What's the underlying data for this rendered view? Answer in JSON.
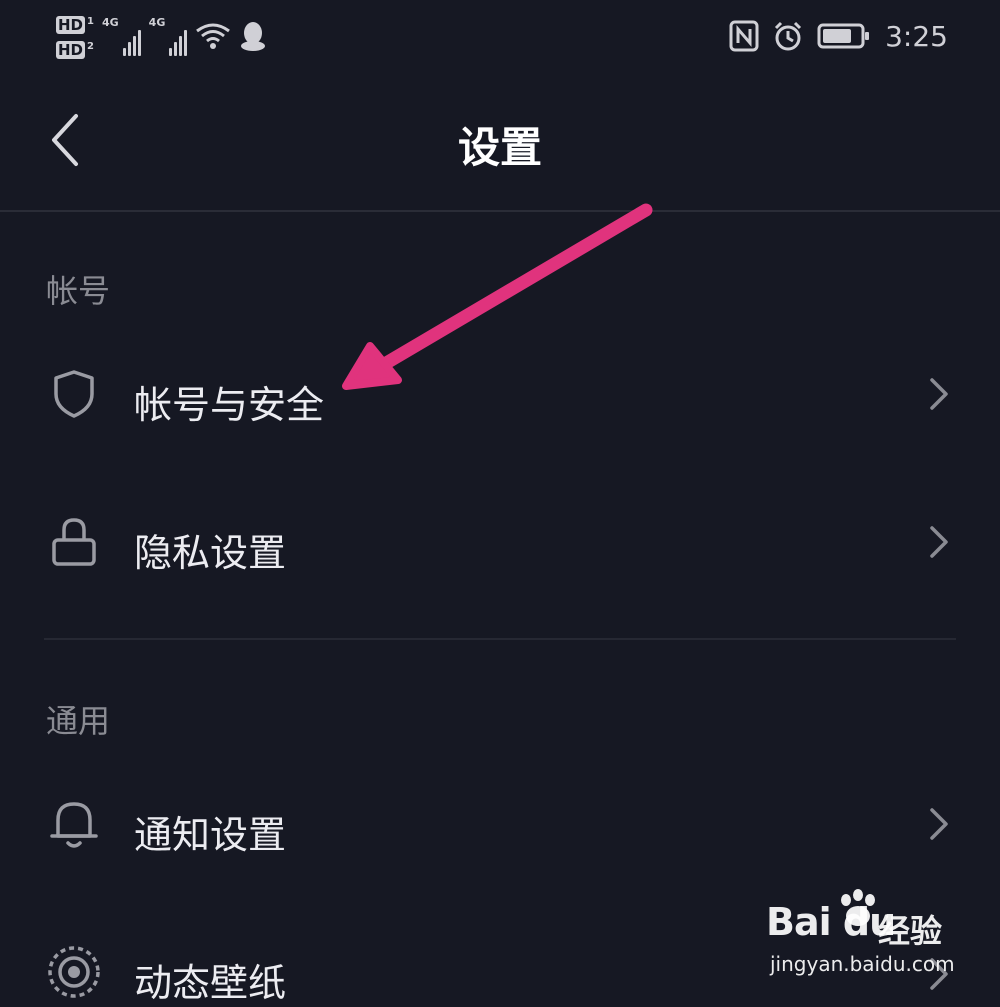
{
  "status_bar": {
    "sim1": "HD",
    "sim1_index": "1",
    "sim2": "HD",
    "sim2_index": "2",
    "network1": "4G",
    "network2": "4G",
    "time": "3:25",
    "icons": [
      "wifi-icon",
      "qq-icon",
      "nfc-icon",
      "alarm-icon",
      "battery-icon"
    ]
  },
  "header": {
    "title": "设置"
  },
  "sections": [
    {
      "title": "帐号",
      "items": [
        {
          "label": "帐号与安全",
          "icon": "shield-icon"
        },
        {
          "label": "隐私设置",
          "icon": "lock-icon"
        }
      ]
    },
    {
      "title": "通用",
      "items": [
        {
          "label": "通知设置",
          "icon": "bell-icon"
        },
        {
          "label": "动态壁纸",
          "icon": "live-wallpaper-icon"
        }
      ]
    }
  ],
  "watermark": {
    "brand": "Bai du",
    "suffix": "经验",
    "url": "jingyan.baidu.com"
  },
  "colors": {
    "background": "#161823",
    "text": "#ececf1",
    "section_text": "#8a8b93",
    "icon": "#9a9ba3",
    "annotation_arrow": "#e0337d"
  }
}
